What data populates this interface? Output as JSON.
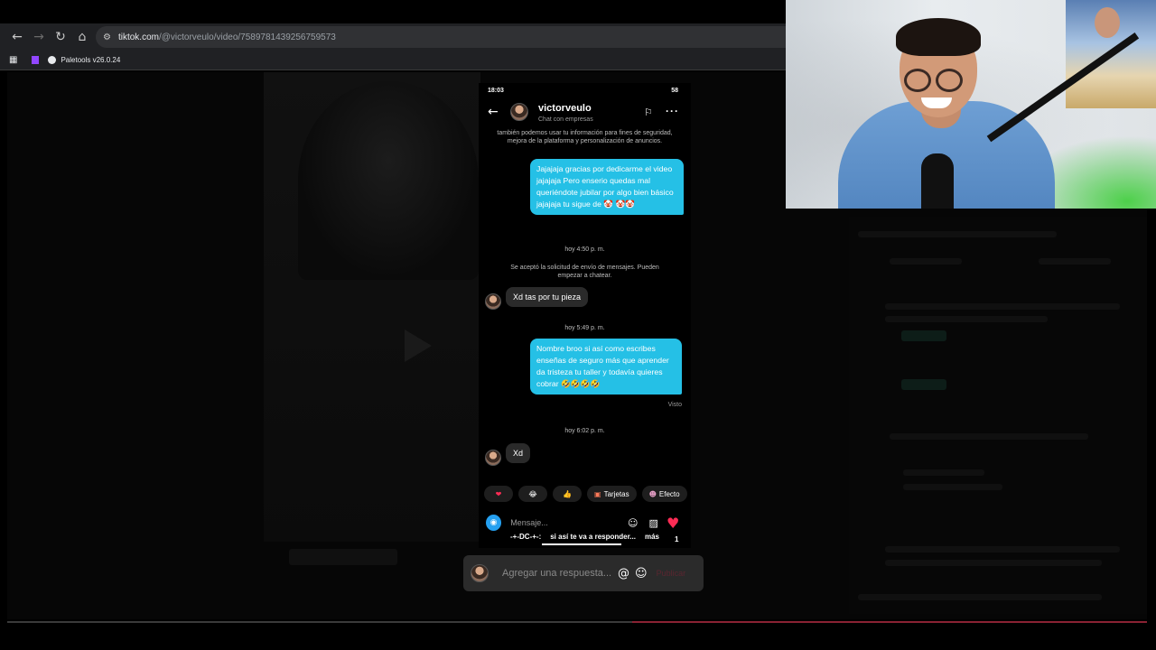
{
  "browser": {
    "url_host": "tiktok.com",
    "url_path": "/@victorveulo/video/7589781439256759573",
    "bookmark": "Paletools v26.0.24"
  },
  "phone": {
    "time": "18:03",
    "battery": "58",
    "contact_name": "victorveulo",
    "contact_sub": "Chat con empresas",
    "notice": "también podemos usar tu información para fines de seguridad, mejora de la plataforma y personalización de anuncios.",
    "messages": [
      {
        "text": "Jajajaja gracias por dedicarme el video jajajaja Pero enserio quedas mal queriéndote jubilar por algo bien básico jajajaja tu sigue de 🤡 🤡🤡"
      },
      {
        "text": "hoy 4:50 p. m."
      },
      {
        "text": "Se aceptó la solicitud de envío de mensajes. Pueden empezar a chatear."
      },
      {
        "text": "Xd tas por tu pieza"
      },
      {
        "text": "hoy 5:49 p. m."
      },
      {
        "text": "Nombre broo si así como escribes enseñas de seguro más que aprender da tristeza tu taller y todavía quieres cobrar 🤣🤣🤣🤣"
      },
      {
        "text": "Visto"
      },
      {
        "text": "hoy 6:02 p. m."
      },
      {
        "text": "Xd"
      }
    ],
    "quick": {
      "heart": "❤",
      "laugh": "😂",
      "thumb": "👍",
      "cards": "Tarjetas",
      "effects": "Efecto"
    },
    "input_placeholder": "Mensaje..."
  },
  "overlay": {
    "caption_user": "-+-DC-+-:",
    "caption_text": "si así te va a responder...",
    "caption_more": "más",
    "like_count": "1",
    "reply_placeholder": "Agregar una respuesta...",
    "reply_post": "Publicar"
  },
  "colors": {
    "bubble_me": "#25c0e6",
    "like": "#fe2c55"
  }
}
